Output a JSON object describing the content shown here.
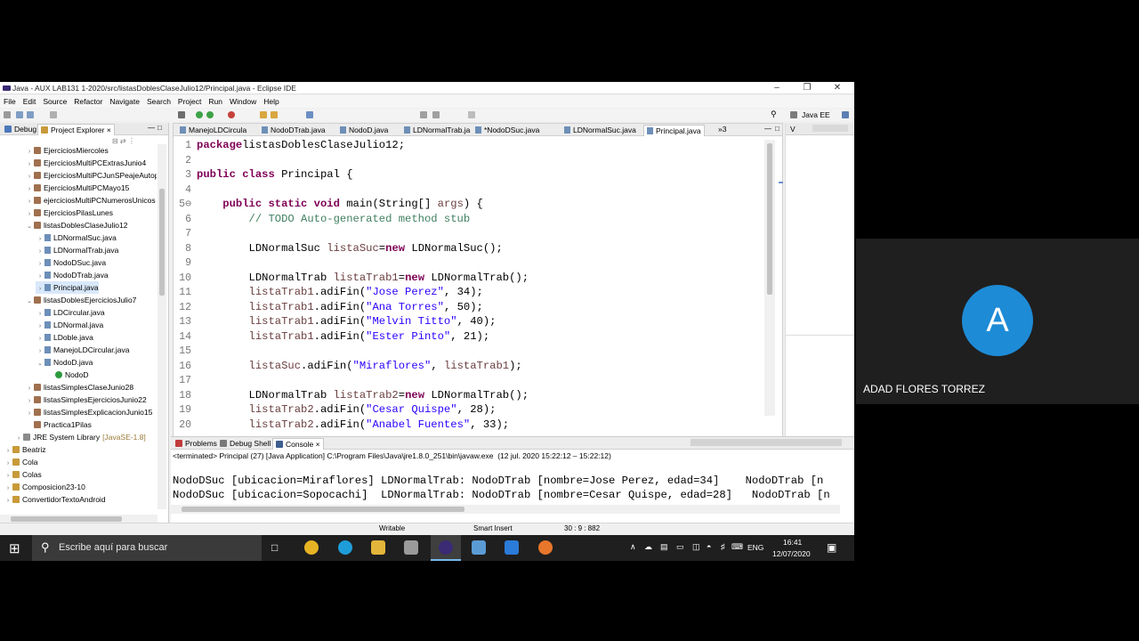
{
  "window": {
    "title": "Java - AUX LAB131 1-2020/src/listasDoblesClaseJulio12/Principal.java - Eclipse IDE",
    "minimize_icon": "minimize-icon",
    "restore_icon": "restore-icon",
    "close_icon": "close-icon"
  },
  "menu": [
    "File",
    "Edit",
    "Source",
    "Refactor",
    "Navigate",
    "Search",
    "Project",
    "Run",
    "Window",
    "Help"
  ],
  "perspective": "Java EE",
  "left_tabs": {
    "debug": "Debug",
    "explorer": "Project Explorer"
  },
  "tree": [
    {
      "label": "EjerciciosMiercoles",
      "indent": 2,
      "kind": "pkg",
      "twisty": ">"
    },
    {
      "label": "EjerciciosMultiPCExtrasJunio4",
      "indent": 2,
      "kind": "pkg",
      "twisty": ">"
    },
    {
      "label": "EjerciciosMultiPCJunSPeajeAutop",
      "indent": 2,
      "kind": "pkg",
      "twisty": ">"
    },
    {
      "label": "EjerciciosMultiPCMayo15",
      "indent": 2,
      "kind": "pkg",
      "twisty": ">"
    },
    {
      "label": "ejerciciosMultiPCNumerosUnicos",
      "indent": 2,
      "kind": "pkg",
      "twisty": ">"
    },
    {
      "label": "EjerciciosPilasLunes",
      "indent": 2,
      "kind": "pkg",
      "twisty": ">"
    },
    {
      "label": "listasDoblesClaseJulio12",
      "indent": 2,
      "kind": "pkg",
      "twisty": "v"
    },
    {
      "label": "LDNormalSuc.java",
      "indent": 3,
      "kind": "file",
      "twisty": ">"
    },
    {
      "label": "LDNormalTrab.java",
      "indent": 3,
      "kind": "file",
      "twisty": ">"
    },
    {
      "label": "NodoDSuc.java",
      "indent": 3,
      "kind": "file",
      "twisty": ">"
    },
    {
      "label": "NodoDTrab.java",
      "indent": 3,
      "kind": "file",
      "twisty": ">"
    },
    {
      "label": "Principal.java",
      "indent": 3,
      "kind": "file",
      "twisty": ">",
      "selected": true
    },
    {
      "label": "listasDoblesEjerciciosJulio7",
      "indent": 2,
      "kind": "pkg",
      "twisty": "v"
    },
    {
      "label": "LDCircular.java",
      "indent": 3,
      "kind": "file",
      "twisty": ">"
    },
    {
      "label": "LDNormal.java",
      "indent": 3,
      "kind": "file",
      "twisty": ">"
    },
    {
      "label": "LDoble.java",
      "indent": 3,
      "kind": "file",
      "twisty": ">"
    },
    {
      "label": "ManejoLDCircular.java",
      "indent": 3,
      "kind": "file",
      "twisty": ">"
    },
    {
      "label": "NodoD.java",
      "indent": 3,
      "kind": "file",
      "twisty": "v"
    },
    {
      "label": "NodoD",
      "indent": 4,
      "kind": "cls",
      "twisty": ""
    },
    {
      "label": "listasSimplesClaseJunio28",
      "indent": 2,
      "kind": "pkg",
      "twisty": ">"
    },
    {
      "label": "listasSimplesEjerciciosJunio22",
      "indent": 2,
      "kind": "pkg",
      "twisty": ">"
    },
    {
      "label": "listasSimplesExplicacionJunio15",
      "indent": 2,
      "kind": "pkg",
      "twisty": ">"
    },
    {
      "label": "Practica1Pilas",
      "indent": 2,
      "kind": "pkg",
      "twisty": ""
    },
    {
      "label": "JRE System Library",
      "suffix": "[JavaSE-1.8]",
      "indent": 1,
      "kind": "lib",
      "twisty": ">"
    },
    {
      "label": "Beatriz",
      "indent": 0,
      "kind": "proj",
      "twisty": ">"
    },
    {
      "label": "Cola",
      "indent": 0,
      "kind": "proj",
      "twisty": ">"
    },
    {
      "label": "Colas",
      "indent": 0,
      "kind": "proj",
      "twisty": ">"
    },
    {
      "label": "Composicion23-10",
      "indent": 0,
      "kind": "proj",
      "twisty": ">"
    },
    {
      "label": "ConvertidorTextoAndroid",
      "indent": 0,
      "kind": "proj",
      "twisty": ">"
    }
  ],
  "editor_tabs": [
    "ManejoLDCircula",
    "NodoDTrab.java",
    "NodoD.java",
    "LDNormalTrab.ja",
    "*NodoDSuc.java",
    "LDNormalSuc.java",
    "Principal.java"
  ],
  "editor_more": "»3",
  "code": [
    {
      "n": "1",
      "t": [
        [
          "kw",
          "package"
        ],
        [
          "",
          "listasDoblesClaseJulio12;"
        ]
      ]
    },
    {
      "n": "2",
      "t": []
    },
    {
      "n": "3",
      "t": [
        [
          "kw",
          "public class"
        ],
        [
          "",
          " Principal {"
        ]
      ]
    },
    {
      "n": "4",
      "t": []
    },
    {
      "n": "5⊖",
      "t": [
        [
          "",
          "    "
        ],
        [
          "kw",
          "public static void"
        ],
        [
          "",
          " main(String[] "
        ],
        [
          "va",
          "args"
        ],
        [
          "",
          ") {"
        ]
      ]
    },
    {
      "n": "6",
      "t": [
        [
          "",
          "        "
        ],
        [
          "cm",
          "// TODO Auto-generated method stub"
        ]
      ]
    },
    {
      "n": "7",
      "t": []
    },
    {
      "n": "8",
      "t": [
        [
          "",
          "        LDNormalSuc "
        ],
        [
          "va",
          "listaSuc"
        ],
        [
          "",
          "="
        ],
        [
          "kw",
          "new"
        ],
        [
          "",
          " LDNormalSuc();"
        ]
      ]
    },
    {
      "n": "9",
      "t": []
    },
    {
      "n": "10",
      "t": [
        [
          "",
          "        LDNormalTrab "
        ],
        [
          "va",
          "listaTrab1"
        ],
        [
          "",
          "="
        ],
        [
          "kw",
          "new"
        ],
        [
          "",
          " LDNormalTrab();"
        ]
      ]
    },
    {
      "n": "11",
      "t": [
        [
          "",
          "        "
        ],
        [
          "va",
          "listaTrab1"
        ],
        [
          "",
          ".adiFin("
        ],
        [
          "st",
          "\"Jose Perez\""
        ],
        [
          "",
          ", 34);"
        ]
      ]
    },
    {
      "n": "12",
      "t": [
        [
          "",
          "        "
        ],
        [
          "va",
          "listaTrab1"
        ],
        [
          "",
          ".adiFin("
        ],
        [
          "st",
          "\"Ana Torres\""
        ],
        [
          "",
          ", 50);"
        ]
      ]
    },
    {
      "n": "13",
      "t": [
        [
          "",
          "        "
        ],
        [
          "va",
          "listaTrab1"
        ],
        [
          "",
          ".adiFin("
        ],
        [
          "st",
          "\"Melvin Titto\""
        ],
        [
          "",
          ", 40);"
        ]
      ]
    },
    {
      "n": "14",
      "t": [
        [
          "",
          "        "
        ],
        [
          "va",
          "listaTrab1"
        ],
        [
          "",
          ".adiFin("
        ],
        [
          "st",
          "\"Ester Pinto\""
        ],
        [
          "",
          ", 21);"
        ]
      ]
    },
    {
      "n": "15",
      "t": []
    },
    {
      "n": "16",
      "t": [
        [
          "",
          "        "
        ],
        [
          "va",
          "listaSuc"
        ],
        [
          "",
          ".adiFin("
        ],
        [
          "st",
          "\"Miraflores\""
        ],
        [
          "",
          ", "
        ],
        [
          "va",
          "listaTrab1"
        ],
        [
          "",
          ");"
        ]
      ]
    },
    {
      "n": "17",
      "t": []
    },
    {
      "n": "18",
      "t": [
        [
          "",
          "        LDNormalTrab "
        ],
        [
          "va",
          "listaTrab2"
        ],
        [
          "",
          "="
        ],
        [
          "kw",
          "new"
        ],
        [
          "",
          " LDNormalTrab();"
        ]
      ]
    },
    {
      "n": "19",
      "t": [
        [
          "",
          "        "
        ],
        [
          "va",
          "listaTrab2"
        ],
        [
          "",
          ".adiFin("
        ],
        [
          "st",
          "\"Cesar Quispe\""
        ],
        [
          "",
          ", 28);"
        ]
      ]
    },
    {
      "n": "20",
      "t": [
        [
          "",
          "        "
        ],
        [
          "va",
          "listaTrab2"
        ],
        [
          "",
          ".adiFin("
        ],
        [
          "st",
          "\"Anabel Fuentes\""
        ],
        [
          "",
          ", 33);"
        ]
      ]
    }
  ],
  "console_tabs": {
    "problems": "Problems",
    "debug_shell": "Debug Shell",
    "console": "Console"
  },
  "console": {
    "header": "<terminated> Principal (27) [Java Application] C:\\Program Files\\Java\\jre1.8.0_251\\bin\\javaw.exe  (12 jul. 2020 15:22:12 – 15:22:12)",
    "lines": [
      "NodoDSuc [ubicacion=Miraflores] LDNormalTrab: NodoDTrab [nombre=Jose Perez, edad=34]    NodoDTrab [n",
      "NodoDSuc [ubicacion=Sopocachi]  LDNormalTrab: NodoDTrab [nombre=Cesar Quispe, edad=28]   NodoDTrab [n"
    ]
  },
  "status": {
    "writable": "Writable",
    "insert": "Smart Insert",
    "position": "30 : 9 : 882"
  },
  "taskbar": {
    "search_placeholder": "Escribe aquí para buscar",
    "lang": "ENG",
    "time": "16:41",
    "date": "12/07/2020"
  },
  "participant": {
    "initial": "A",
    "name": "ADAD FLORES TORREZ",
    "color": "#1e8bd6"
  }
}
